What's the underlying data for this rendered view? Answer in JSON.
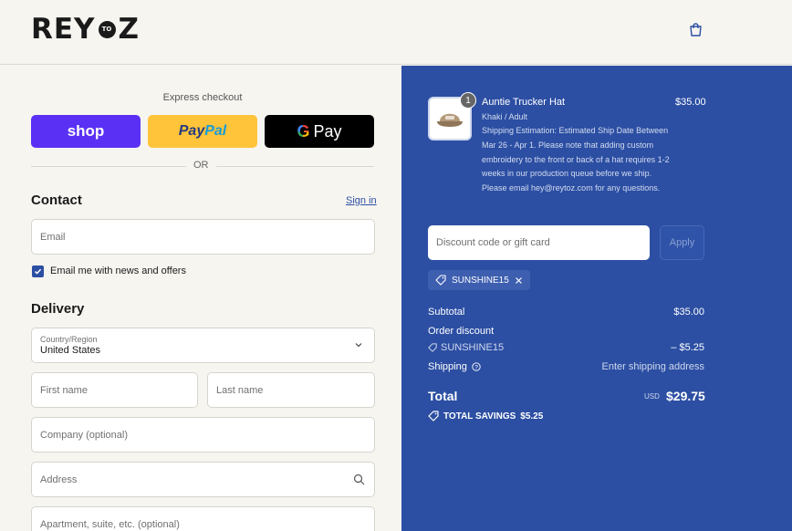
{
  "brand": {
    "name_left": "REY",
    "name_mid": "TO",
    "name_right": "Z"
  },
  "express": {
    "label": "Express checkout",
    "shop_label": "shop",
    "paypal_a": "Pay",
    "paypal_b": "Pal",
    "gpay_g": "G",
    "gpay_label": "Pay",
    "or_text": "OR"
  },
  "contact": {
    "title": "Contact",
    "signin": "Sign in",
    "email_placeholder": "Email",
    "newsletter_label": "Email me with news and offers",
    "newsletter_checked": true
  },
  "delivery": {
    "title": "Delivery",
    "country_label": "Country/Region",
    "country_value": "United States",
    "first_name": "First name",
    "last_name": "Last name",
    "company": "Company (optional)",
    "address": "Address",
    "apartment": "Apartment, suite, etc. (optional)"
  },
  "cart": {
    "item": {
      "quantity": "1",
      "name": "Auntie Trucker Hat",
      "price": "$35.00",
      "variant": "Khaki / Adult",
      "note": "Shipping Estimation: Estimated Ship Date Between Mar 26 - Apr 1. Please note that adding custom embroidery to the front or back of a hat requires 1-2 weeks in our production queue before we ship. Please email hey@reytoz.com for any questions."
    },
    "discount_placeholder": "Discount code or gift card",
    "apply_label": "Apply",
    "applied_code": "SUNSHINE15",
    "summary": {
      "subtotal_label": "Subtotal",
      "subtotal_value": "$35.00",
      "order_discount_label": "Order discount",
      "discount_code": "SUNSHINE15",
      "discount_value": "– $5.25",
      "shipping_label": "Shipping",
      "shipping_value": "Enter shipping address",
      "total_label": "Total",
      "currency": "USD",
      "total_value": "$29.75",
      "savings_label": "TOTAL SAVINGS",
      "savings_value": "$5.25"
    }
  },
  "colors": {
    "panel": "#2c4fa3",
    "shop": "#5a31f4",
    "paypal": "#ffc439",
    "background": "#f7f5f0"
  }
}
